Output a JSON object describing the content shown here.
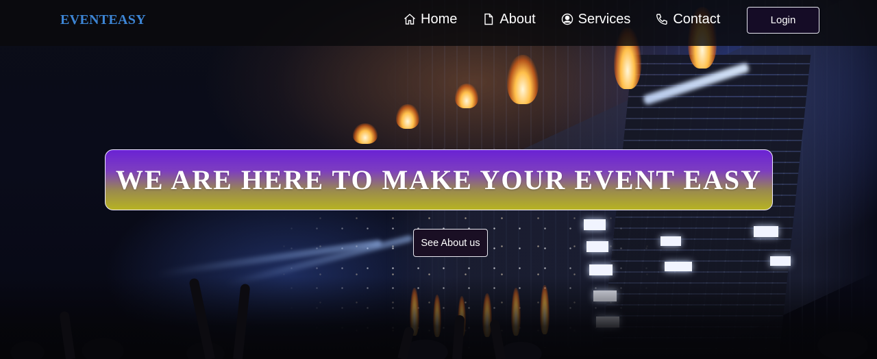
{
  "navbar": {
    "brand": "EVENTEASY",
    "links": [
      {
        "label": "Home",
        "icon": "home-icon"
      },
      {
        "label": "About",
        "icon": "document-icon"
      },
      {
        "label": "Services",
        "icon": "user-circle-icon"
      },
      {
        "label": "Contact",
        "icon": "phone-icon"
      }
    ],
    "login_label": "Login"
  },
  "hero": {
    "headline": "WE ARE HERE TO MAKE YOUR EVENT EASY",
    "cta_label": "See About us",
    "background": "concert-stage-photo"
  },
  "colors": {
    "brand": "#3d86d6",
    "navbar_bg": "#0a0a0c",
    "headline_gradient_top": "#6a22d4",
    "headline_gradient_bottom": "#b7b322",
    "button_bg": "#150c26"
  }
}
